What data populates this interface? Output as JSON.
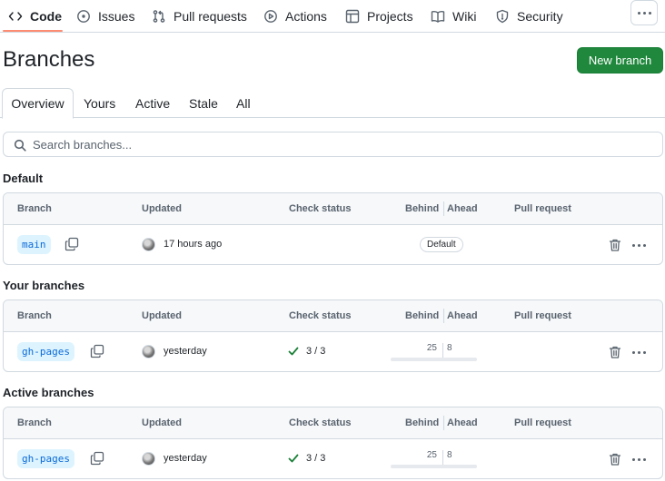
{
  "nav": {
    "items": [
      {
        "label": "Code",
        "icon": "code-icon"
      },
      {
        "label": "Issues",
        "icon": "issue-opened-icon"
      },
      {
        "label": "Pull requests",
        "icon": "git-pull-request-icon"
      },
      {
        "label": "Actions",
        "icon": "play-icon"
      },
      {
        "label": "Projects",
        "icon": "table-icon"
      },
      {
        "label": "Wiki",
        "icon": "book-icon"
      },
      {
        "label": "Security",
        "icon": "shield-icon"
      }
    ],
    "selected": "Code"
  },
  "header": {
    "title": "Branches",
    "new_branch_label": "New branch"
  },
  "tabs": [
    "Overview",
    "Yours",
    "Active",
    "Stale",
    "All"
  ],
  "selected_tab": "Overview",
  "search": {
    "placeholder": "Search branches..."
  },
  "columns": {
    "branch": "Branch",
    "updated": "Updated",
    "check_status": "Check status",
    "behind": "Behind",
    "ahead": "Ahead",
    "pull_request": "Pull request"
  },
  "sections": [
    {
      "heading": "Default",
      "rows": [
        {
          "branch": "main",
          "updated": "17 hours ago",
          "check": "",
          "badge": "Default",
          "behind": "",
          "ahead": ""
        }
      ]
    },
    {
      "heading": "Your branches",
      "rows": [
        {
          "branch": "gh-pages",
          "updated": "yesterday",
          "check": "3 / 3",
          "badge": "",
          "behind": "25",
          "ahead": "8"
        }
      ]
    },
    {
      "heading": "Active branches",
      "rows": [
        {
          "branch": "gh-pages",
          "updated": "yesterday",
          "check": "3 / 3",
          "badge": "",
          "behind": "25",
          "ahead": "8"
        }
      ]
    }
  ],
  "colors": {
    "primary_button": "#1f883d",
    "branch_pill_bg": "#ddf4ff",
    "branch_pill_text": "#0969da",
    "success": "#1a7f37",
    "nav_underline": "#fd8c73"
  }
}
